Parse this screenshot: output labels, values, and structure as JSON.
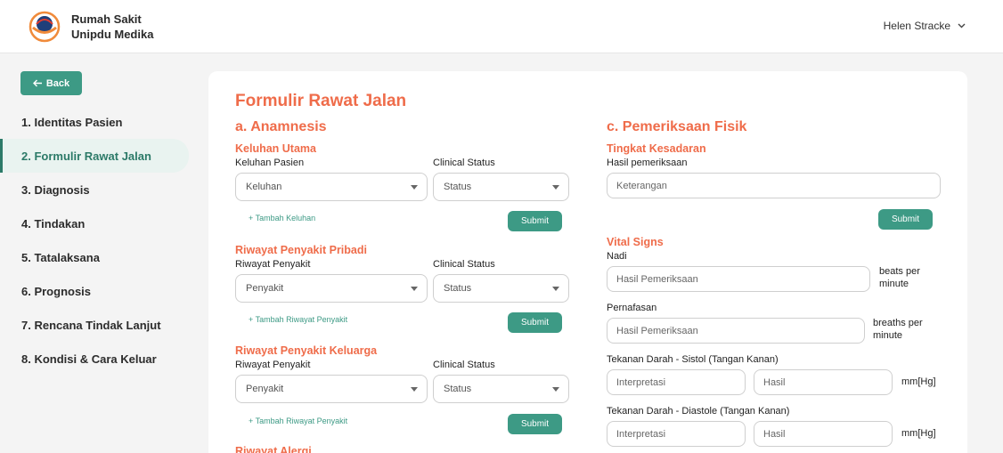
{
  "header": {
    "brand_line1": "Rumah Sakit",
    "brand_line2": "Unipdu Medika",
    "user": "Helen Stracke"
  },
  "sidebar": {
    "back_label": "Back",
    "items": [
      {
        "label": "1. Identitas Pasien"
      },
      {
        "label": "2. Formulir Rawat Jalan"
      },
      {
        "label": "3. Diagnosis"
      },
      {
        "label": "4. Tindakan"
      },
      {
        "label": "5. Tatalaksana"
      },
      {
        "label": "6. Prognosis"
      },
      {
        "label": "7. Rencana Tindak Lanjut"
      },
      {
        "label": "8. Kondisi & Cara Keluar"
      }
    ]
  },
  "form": {
    "title": "Formulir Rawat Jalan",
    "anamnesis": {
      "title": "a. Anamnesis",
      "keluhan": {
        "title": "Keluhan Utama",
        "label": "Keluhan Pasien",
        "status_label": "Clinical Status",
        "value": "Keluhan",
        "status": "Status",
        "add": "+ Tambah Keluhan",
        "submit": "Submit"
      },
      "pribadi": {
        "title": "Riwayat Penyakit Pribadi",
        "label": "Riwayat Penyakit",
        "status_label": "Clinical Status",
        "value": "Penyakit",
        "status": "Status",
        "add": "+ Tambah Riwayat Penyakit",
        "submit": "Submit"
      },
      "keluarga": {
        "title": "Riwayat Penyakit Keluarga",
        "label": "Riwayat Penyakit",
        "status_label": "Clinical Status",
        "value": "Penyakit",
        "status": "Status",
        "add": "+ Tambah Riwayat Penyakit",
        "submit": "Submit"
      },
      "alergi": {
        "title": "Riwayat Alergi"
      }
    },
    "fisik": {
      "title": "c. Pemeriksaan Fisik",
      "kesadaran": {
        "title": "Tingkat Kesadaran",
        "label": "Hasil pemeriksaan",
        "placeholder": "Keterangan",
        "submit": "Submit"
      },
      "vital": {
        "title": "Vital Signs",
        "nadi": {
          "label": "Nadi",
          "placeholder": "Hasil Pemeriksaan",
          "unit": "beats per minute"
        },
        "napas": {
          "label": "Pernafasan",
          "placeholder": "Hasil Pemeriksaan",
          "unit": "breaths per minute"
        },
        "sistol": {
          "label": "Tekanan Darah - Sistol (Tangan Kanan)",
          "placeholder1": "Interpretasi",
          "placeholder2": "Hasil",
          "unit": "mm[Hg]"
        },
        "diastole": {
          "label": "Tekanan Darah - Diastole (Tangan Kanan)",
          "placeholder1": "Interpretasi",
          "placeholder2": "Hasil",
          "unit": "mm[Hg]"
        }
      }
    }
  },
  "colors": {
    "accent": "#ef6c4a",
    "primary": "#3d9a85"
  }
}
